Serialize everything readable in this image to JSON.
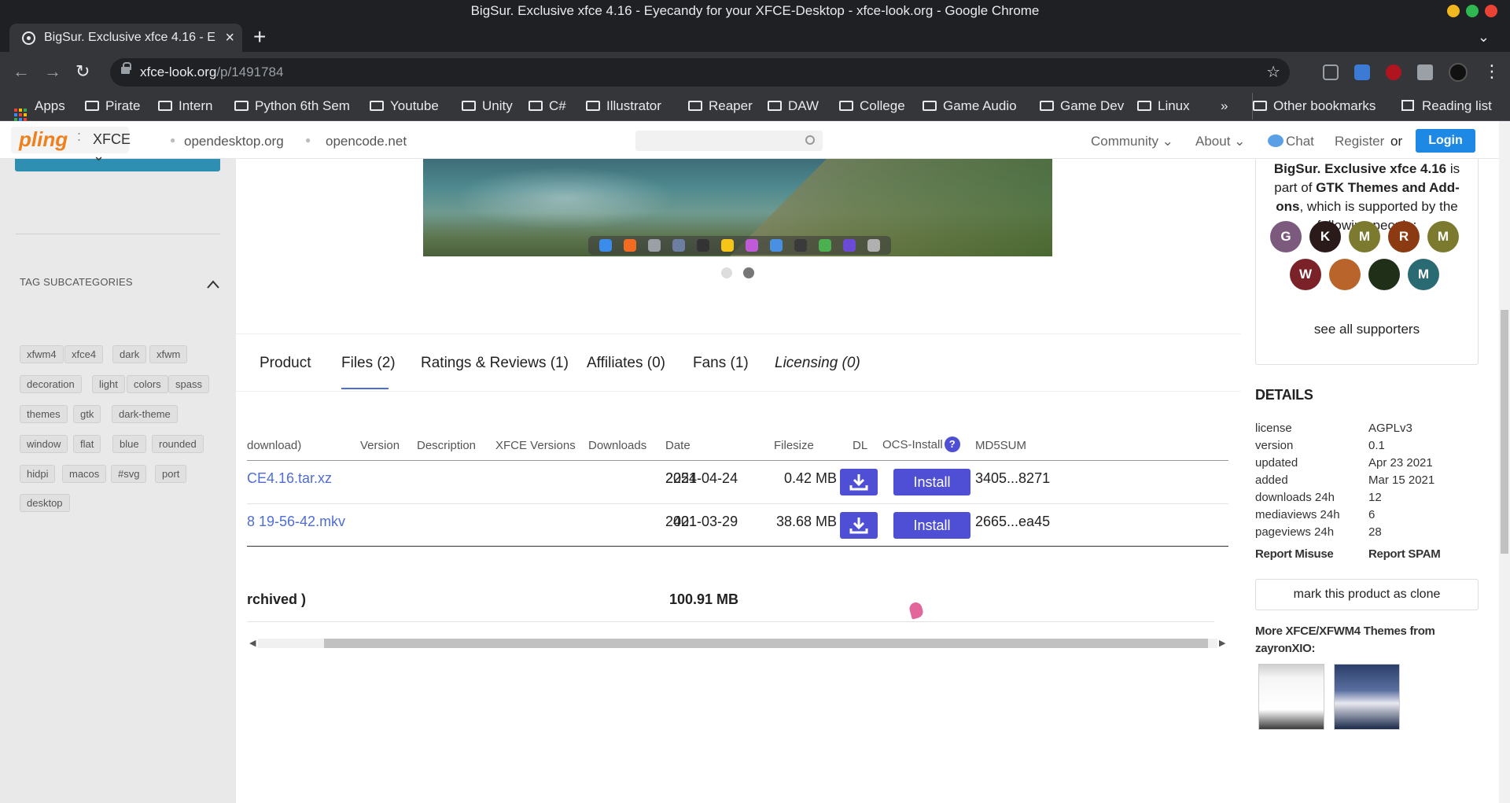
{
  "window": {
    "title": "BigSur. Exclusive xfce 4.16 - Eyecandy for your XFCE-Desktop - xfce-look.org - Google Chrome",
    "tab_title": "BigSur. Exclusive xfce 4.16 - E",
    "tab_close": "×",
    "new_tab": "+",
    "tab_search": "⌄",
    "controls_colors": [
      "#f2b61e",
      "#2fb84f",
      "#ea4335"
    ]
  },
  "toolbar": {
    "back": "←",
    "forward": "→",
    "reload": "↻",
    "url_domain": "xfce-look.org",
    "url_path": "/p/1491784",
    "star": "☆"
  },
  "bookmarks": {
    "apps": "Apps",
    "folders": [
      "Pirate",
      "Intern",
      "Python 6th Sem",
      "Youtube",
      "Unity",
      "C#",
      "Illustrator",
      "Reaper",
      "DAW",
      "College",
      "Game Audio",
      "Game Dev",
      "Linux"
    ],
    "overflow": "»",
    "other": "Other bookmarks",
    "reading_list": "Reading list"
  },
  "header": {
    "logo": "pling",
    "logo_sep": ":",
    "store": "XFCE ⌄",
    "links": [
      "opendesktop.org",
      "opencode.net"
    ],
    "community": "Community ⌄",
    "about": "About ⌄",
    "chat": "Chat",
    "register": "Register",
    "or": "or",
    "login": "Login"
  },
  "sidebar": {
    "tag_title": "TAG SUBCATEGORIES",
    "tags": [
      "xfwm4",
      "xfce4",
      "dark",
      "xfwm",
      "decoration",
      "light",
      "colors",
      "spass",
      "themes",
      "gtk",
      "dark-theme",
      "window",
      "flat",
      "blue",
      "rounded",
      "hidpi",
      "macos",
      "#svg",
      "port",
      "desktop"
    ]
  },
  "gallery": {
    "dock_colors": [
      "#3b8bea",
      "#f36b21",
      "#9aa0a6",
      "#6d7fa0",
      "#333333",
      "#f5c518",
      "#c05bd8",
      "#4a90e2",
      "#3a3a3a",
      "#4caf50",
      "#6b4bd6",
      "#b0b0b0"
    ],
    "dot_colors": [
      "#dddddd",
      "#777777"
    ]
  },
  "product_tabs": {
    "items": [
      "Product",
      "Files (2)",
      "Ratings & Reviews (1)",
      "Affiliates (0)",
      "Fans (1)",
      "Licensing (0)"
    ],
    "active_index": 1
  },
  "files": {
    "headers": [
      "download)",
      "Version",
      "Description",
      "XFCE Versions",
      "Downloads",
      "Date",
      "Filesize",
      "DL",
      "OCS-Install",
      "MD5SUM"
    ],
    "help_icon": "?",
    "rows": [
      {
        "name": "CE4.16.tar.xz",
        "downloads": "2254",
        "date": "2021-04-24",
        "filesize": "0.42 MB",
        "install": "Install",
        "md5": "3405...8271"
      },
      {
        "name": "8 19-56-42.mkv",
        "downloads": "401",
        "date": "2021-03-29",
        "filesize": "38.68 MB",
        "install": "Install",
        "md5": "2665...ea45"
      }
    ],
    "footer_label": "rchived )",
    "footer_total": "100.91 MB",
    "scroll_left": "◀",
    "scroll_right": "▶"
  },
  "supporters": {
    "name": "BigSur. Exclusive xfce 4.16",
    "is_part_of": " is part of ",
    "category": "GTK Themes and Add-ons",
    "supported_by": ", which is supported by the following people:",
    "avatars": [
      {
        "letter": "G",
        "color": "#7b5a7e"
      },
      {
        "letter": "K",
        "color": "#2a1a1a"
      },
      {
        "letter": "M",
        "color": "#7b7a2e"
      },
      {
        "letter": "R",
        "color": "#8b3a12"
      },
      {
        "letter": "M",
        "color": "#7b7a2e"
      },
      {
        "letter": "W",
        "color": "#7a2228"
      },
      {
        "letter": "",
        "color": "#b8642a"
      },
      {
        "letter": "",
        "color": "#203018"
      },
      {
        "letter": "M",
        "color": "#2a6a72"
      }
    ],
    "see_all": "see all supporters"
  },
  "details": {
    "title": "DETAILS",
    "rows": [
      {
        "key": "license",
        "value": "AGPLv3"
      },
      {
        "key": "version",
        "value": "0.1"
      },
      {
        "key": "updated",
        "value": "Apr 23 2021"
      },
      {
        "key": "added",
        "value": "Mar 15 2021"
      },
      {
        "key": "downloads 24h",
        "value": "12"
      },
      {
        "key": "mediaviews 24h",
        "value": "6"
      },
      {
        "key": "pageviews 24h",
        "value": "28"
      }
    ],
    "report_misuse": "Report Misuse",
    "report_spam": "Report SPAM",
    "clone_button": "mark this product as clone",
    "more_title": "More XFCE/XFWM4 Themes from zayronXIO:"
  },
  "colors": {
    "accent": "#4f4fd6",
    "link": "#4f6dd6",
    "login": "#1e88e5"
  }
}
